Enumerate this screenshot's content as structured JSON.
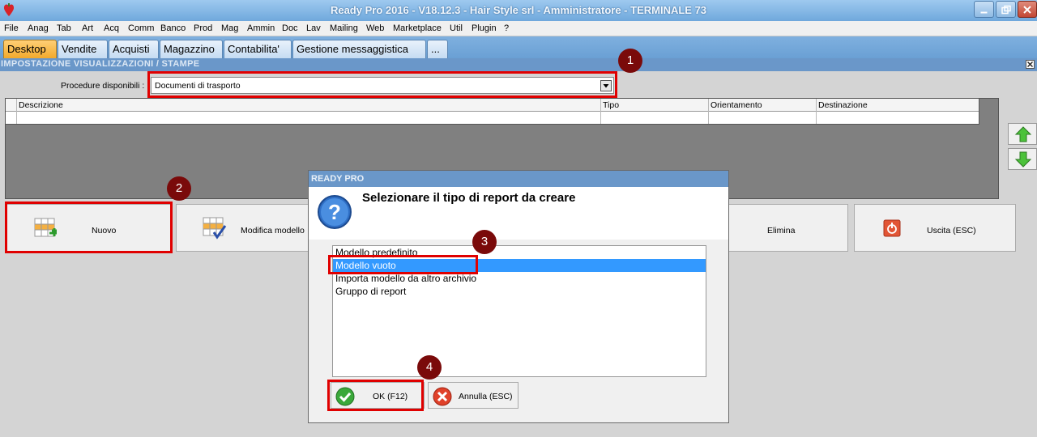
{
  "window": {
    "title": "Ready Pro 2016 - V18.12.3 - Hair Style srl - Amministratore - TERMINALE 73"
  },
  "menu": [
    "File",
    "Anag",
    "Tab",
    "Art",
    "Acq",
    "Comm",
    "Banco",
    "Prod",
    "Mag",
    "Ammin",
    "Doc",
    "Lav",
    "Mailing",
    "Web",
    "Marketplace",
    "Util",
    "Plugin",
    "?"
  ],
  "tabs": [
    "Desktop",
    "Vendite",
    "Acquisti",
    "Magazzino",
    "Contabilita'",
    "Gestione messaggistica",
    "..."
  ],
  "section": {
    "title": "IMPOSTAZIONE VISUALIZZAZIONI / STAMPE"
  },
  "procedure": {
    "label": "Procedure disponibili :",
    "value": "Documenti di trasporto"
  },
  "grid": {
    "columns": [
      "Descrizione",
      "Tipo",
      "Orientamento",
      "Destinazione"
    ]
  },
  "buttons": {
    "new": "Nuovo",
    "edit": "Modifica modello",
    "delete": "Elimina",
    "exit": "Uscita (ESC)"
  },
  "dialog": {
    "title": "READY PRO",
    "heading": "Selezionare il tipo di report da creare",
    "options": [
      "Modello predefinito",
      "Modello vuoto",
      "Importa modello da altro archivio",
      "Gruppo di report"
    ],
    "selected_index": 1,
    "ok_label": "OK (F12)",
    "cancel_label": "Annulla (ESC)"
  },
  "steps": [
    "1",
    "2",
    "3",
    "4"
  ],
  "colors": {
    "highlight_box": "#e00000",
    "step_badge": "#7a0a0a",
    "active_tab": "#f2a92c",
    "selection": "#3399ff"
  }
}
